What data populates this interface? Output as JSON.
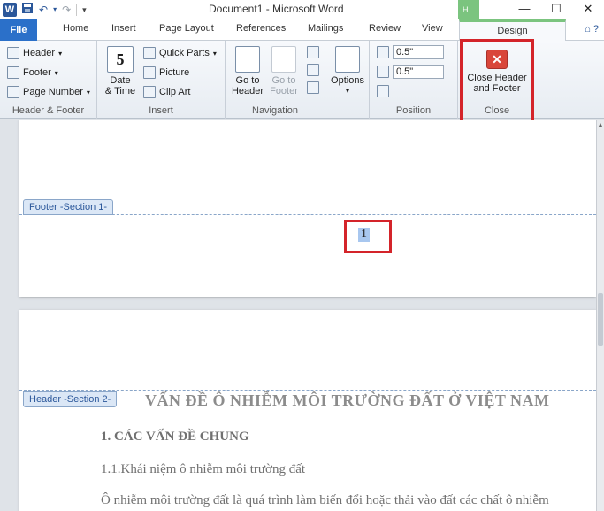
{
  "window": {
    "title": "Document1 - Microsoft Word",
    "app_icon": "W",
    "contextual_tab": "H..."
  },
  "qat": {
    "save_icon": "floppy-icon",
    "undo": "↶",
    "redo": "↷",
    "customize": "▾"
  },
  "window_controls": {
    "minimize": "—",
    "maximize": "☐",
    "close": "✕"
  },
  "tabs": {
    "file": "File",
    "items": [
      "Home",
      "Insert",
      "Page Layout",
      "References",
      "Mailings",
      "Review",
      "View"
    ],
    "design": "Design",
    "help": "⌂ ?"
  },
  "ribbon": {
    "header_footer": {
      "label": "Header & Footer",
      "header": "Header",
      "footer": "Footer",
      "page_number": "Page Number"
    },
    "insert": {
      "label": "Insert",
      "date_time_line1": "Date",
      "date_time_line2": "& Time",
      "calendar_day": "5",
      "quick_parts": "Quick Parts",
      "picture": "Picture",
      "clip_art": "Clip Art"
    },
    "navigation": {
      "label": "Navigation",
      "go_to_header_1": "Go to",
      "go_to_header_2": "Header",
      "go_to_footer_1": "Go to",
      "go_to_footer_2": "Footer"
    },
    "options": {
      "label": "Options"
    },
    "position": {
      "label": "Position",
      "header_from_top": "0.5\"",
      "footer_from_bottom": "0.5\""
    },
    "close": {
      "label": "Close",
      "button_line1": "Close Header",
      "button_line2": "and Footer"
    }
  },
  "document": {
    "footer_section_label": "Footer -Section 1-",
    "page_number": "1",
    "header_section_label": "Header -Section 2-",
    "title": "VẤN ĐỀ Ô NHIỄM MÔI TRƯỜNG ĐẤT Ở VIỆT NAM",
    "heading1": "1. CÁC VẤN ĐỀ CHUNG",
    "heading11": "1.1.Khái niệm ô nhiễm môi trường đất",
    "body": "Ô nhiễm môi trường đất là quá trình làm biến đổi hoặc thải vào đất các chất ô nhiễm"
  },
  "colors": {
    "accent": "#2b70c9",
    "design_tab": "#7bc47f",
    "highlight_box": "#d4242a"
  }
}
